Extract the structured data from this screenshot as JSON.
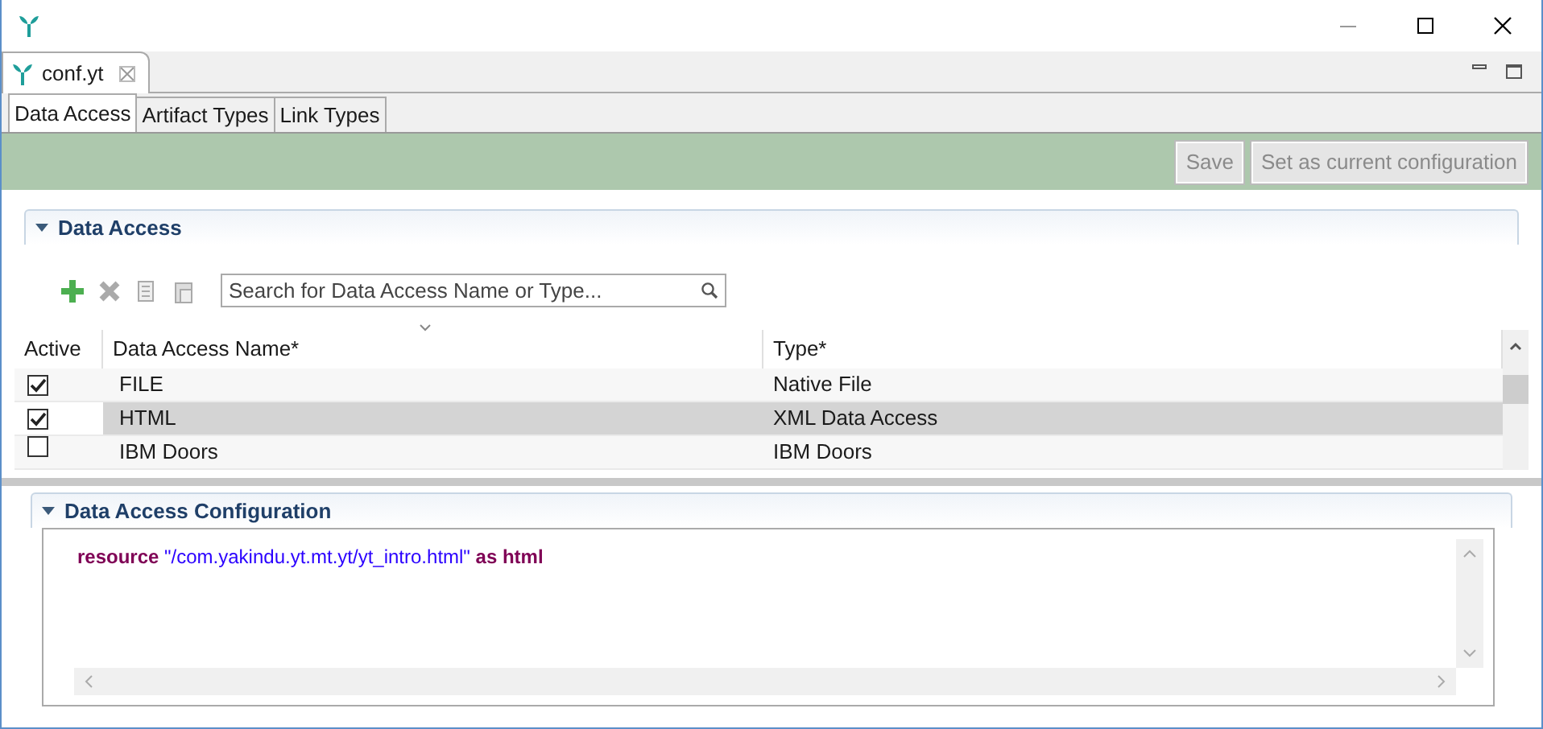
{
  "editor_tab": {
    "label": "conf.yt",
    "selected": true
  },
  "tabs": [
    {
      "label": "Data Access",
      "selected": true
    },
    {
      "label": "Artifact Types",
      "selected": false
    },
    {
      "label": "Link Types",
      "selected": false
    }
  ],
  "actions": [
    {
      "label": "Save",
      "disabled": true
    },
    {
      "label": "Set as current configuration",
      "disabled": true
    }
  ],
  "data_access": {
    "title": "Data Access",
    "expanded": true,
    "toolbar": [
      {
        "kind": "add",
        "disabled": false
      },
      {
        "kind": "delete",
        "disabled": true
      },
      {
        "kind": "copy",
        "disabled": true
      },
      {
        "kind": "paste",
        "disabled": true
      }
    ],
    "search": {
      "placeholder": "Search for Data Access Name or Type..."
    },
    "columns": [
      "Active",
      "Data Access Name*",
      "Type*"
    ],
    "rows": [
      {
        "active": true,
        "name": "FILE",
        "type": "Native File",
        "selected": false
      },
      {
        "active": true,
        "name": "HTML",
        "type": "XML Data Access",
        "selected": true
      },
      {
        "active": false,
        "name": "IBM Doors",
        "type": "IBM Doors",
        "selected": false
      }
    ]
  },
  "configuration": {
    "title": "Data Access Configuration",
    "expanded": true,
    "code": [
      {
        "kind": "keyword",
        "text": "resource"
      },
      {
        "kind": "string",
        "text": "\"/com.yakindu.yt.mt.yt/yt_intro.html\""
      },
      {
        "kind": "keyword",
        "text": "as html"
      }
    ]
  }
}
